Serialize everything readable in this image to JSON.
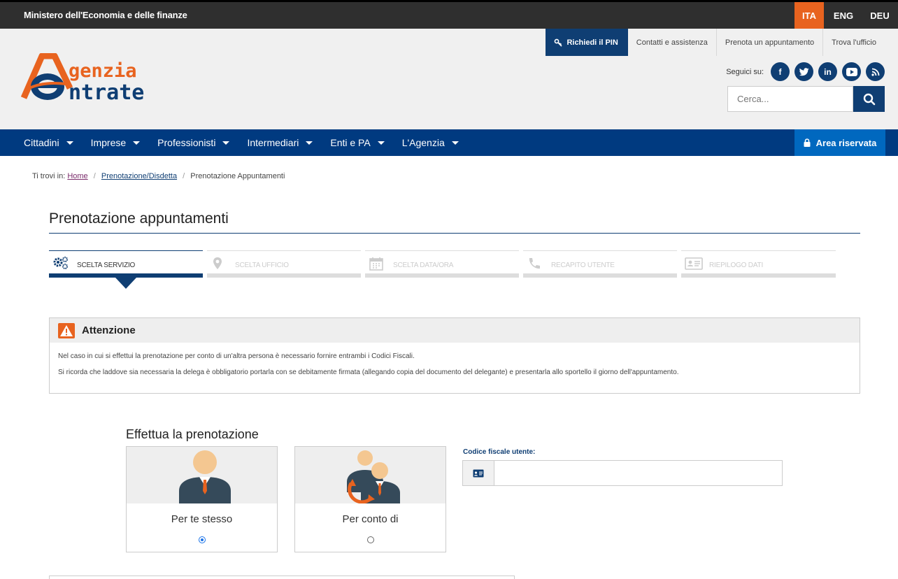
{
  "topbar": {
    "ministry": "Ministero dell'Economia e delle finanze",
    "languages": [
      "ITA",
      "ENG",
      "DEU"
    ]
  },
  "header": {
    "utility_links": {
      "pin": "Richiedi il PIN",
      "contacts": "Contatti e assistenza",
      "appointment": "Prenota un appuntamento",
      "office": "Trova l'ufficio"
    },
    "logo": {
      "line1": "genzia",
      "line2": "ntrate"
    },
    "social_label": "Seguici su:",
    "social": [
      "facebook-icon",
      "twitter-icon",
      "linkedin-icon",
      "youtube-icon",
      "rss-icon"
    ],
    "search_placeholder": "Cerca..."
  },
  "nav": {
    "items": [
      "Cittadini",
      "Imprese",
      "Professionisti",
      "Intermediari",
      "Enti e PA",
      "L'Agenzia"
    ],
    "reserved": "Area riservata"
  },
  "breadcrumb": {
    "prefix": "Ti trovi in:",
    "items": [
      "Home",
      "Prenotazione/Disdetta",
      "Prenotazione Appuntamenti"
    ]
  },
  "page_title": "Prenotazione appuntamenti",
  "steps": [
    {
      "label": "SCELTA SERVIZIO",
      "icon": "gears-icon",
      "active": true
    },
    {
      "label": "SCELTA UFFICIO",
      "icon": "map-marker-icon",
      "active": false
    },
    {
      "label": "SCELTA DATA/ORA",
      "icon": "calendar-icon",
      "active": false
    },
    {
      "label": "RECAPITO UTENTE",
      "icon": "phone-icon",
      "active": false
    },
    {
      "label": "RIEPILOGO DATI",
      "icon": "id-card-icon",
      "active": false
    }
  ],
  "alert": {
    "title": "Attenzione",
    "line1": "Nel caso in cui si effettui la prenotazione per conto di un'altra persona è necessario fornire entrambi i Codici Fiscali.",
    "line2": "Si ricorda che laddove sia necessaria la delega è obbligatorio portarla con se debitamente firmata (allegando copia del documento del delegante) e presentarla allo sportello il giorno dell'appuntamento."
  },
  "booking": {
    "title": "Effettua la prenotazione",
    "options": [
      {
        "label": "Per te stesso",
        "selected": true
      },
      {
        "label": "Per conto di",
        "selected": false
      }
    ],
    "cf_label": "Codice fiscale utente:",
    "cf_value": ""
  },
  "colors": {
    "navy": "#0f3e73",
    "nav": "#003a80",
    "orange": "#e8631f",
    "reserved": "#0068bf"
  }
}
